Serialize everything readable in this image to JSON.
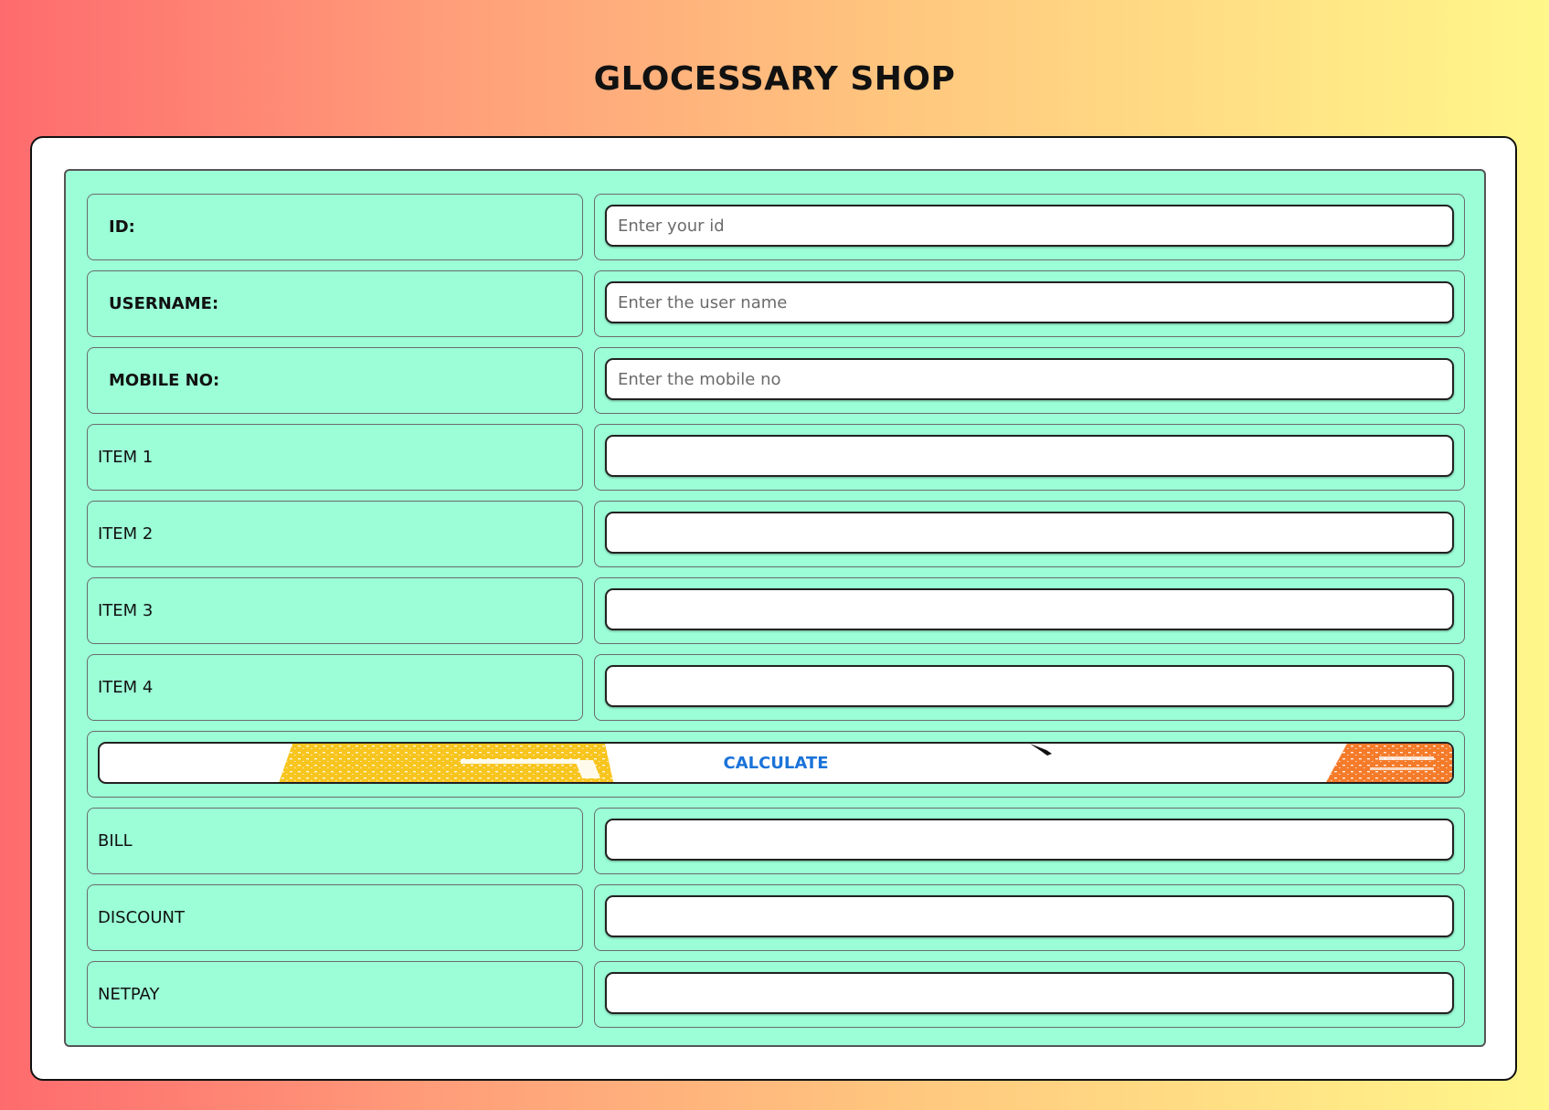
{
  "title": "GLOCESSARY SHOP",
  "fields": {
    "id": {
      "label": "ID:",
      "placeholder": "Enter your id"
    },
    "username": {
      "label": "USERNAME:",
      "placeholder": "Enter the user name"
    },
    "mobile": {
      "label": "MOBILE NO:",
      "placeholder": "Enter the mobile no"
    },
    "item1": {
      "label": "ITEM 1"
    },
    "item2": {
      "label": "ITEM 2"
    },
    "item3": {
      "label": "ITEM 3"
    },
    "item4": {
      "label": "ITEM 4"
    },
    "bill": {
      "label": "BILL"
    },
    "discount": {
      "label": "DISCOUNT"
    },
    "netpay": {
      "label": "NETPAY"
    }
  },
  "calculate_button": {
    "label": "CALCULATE"
  },
  "colors": {
    "form_background": "#9bfed7",
    "button_text": "#1a73d9",
    "paint_yellow": "#f7c51e",
    "paint_orange": "#f47b2a"
  }
}
